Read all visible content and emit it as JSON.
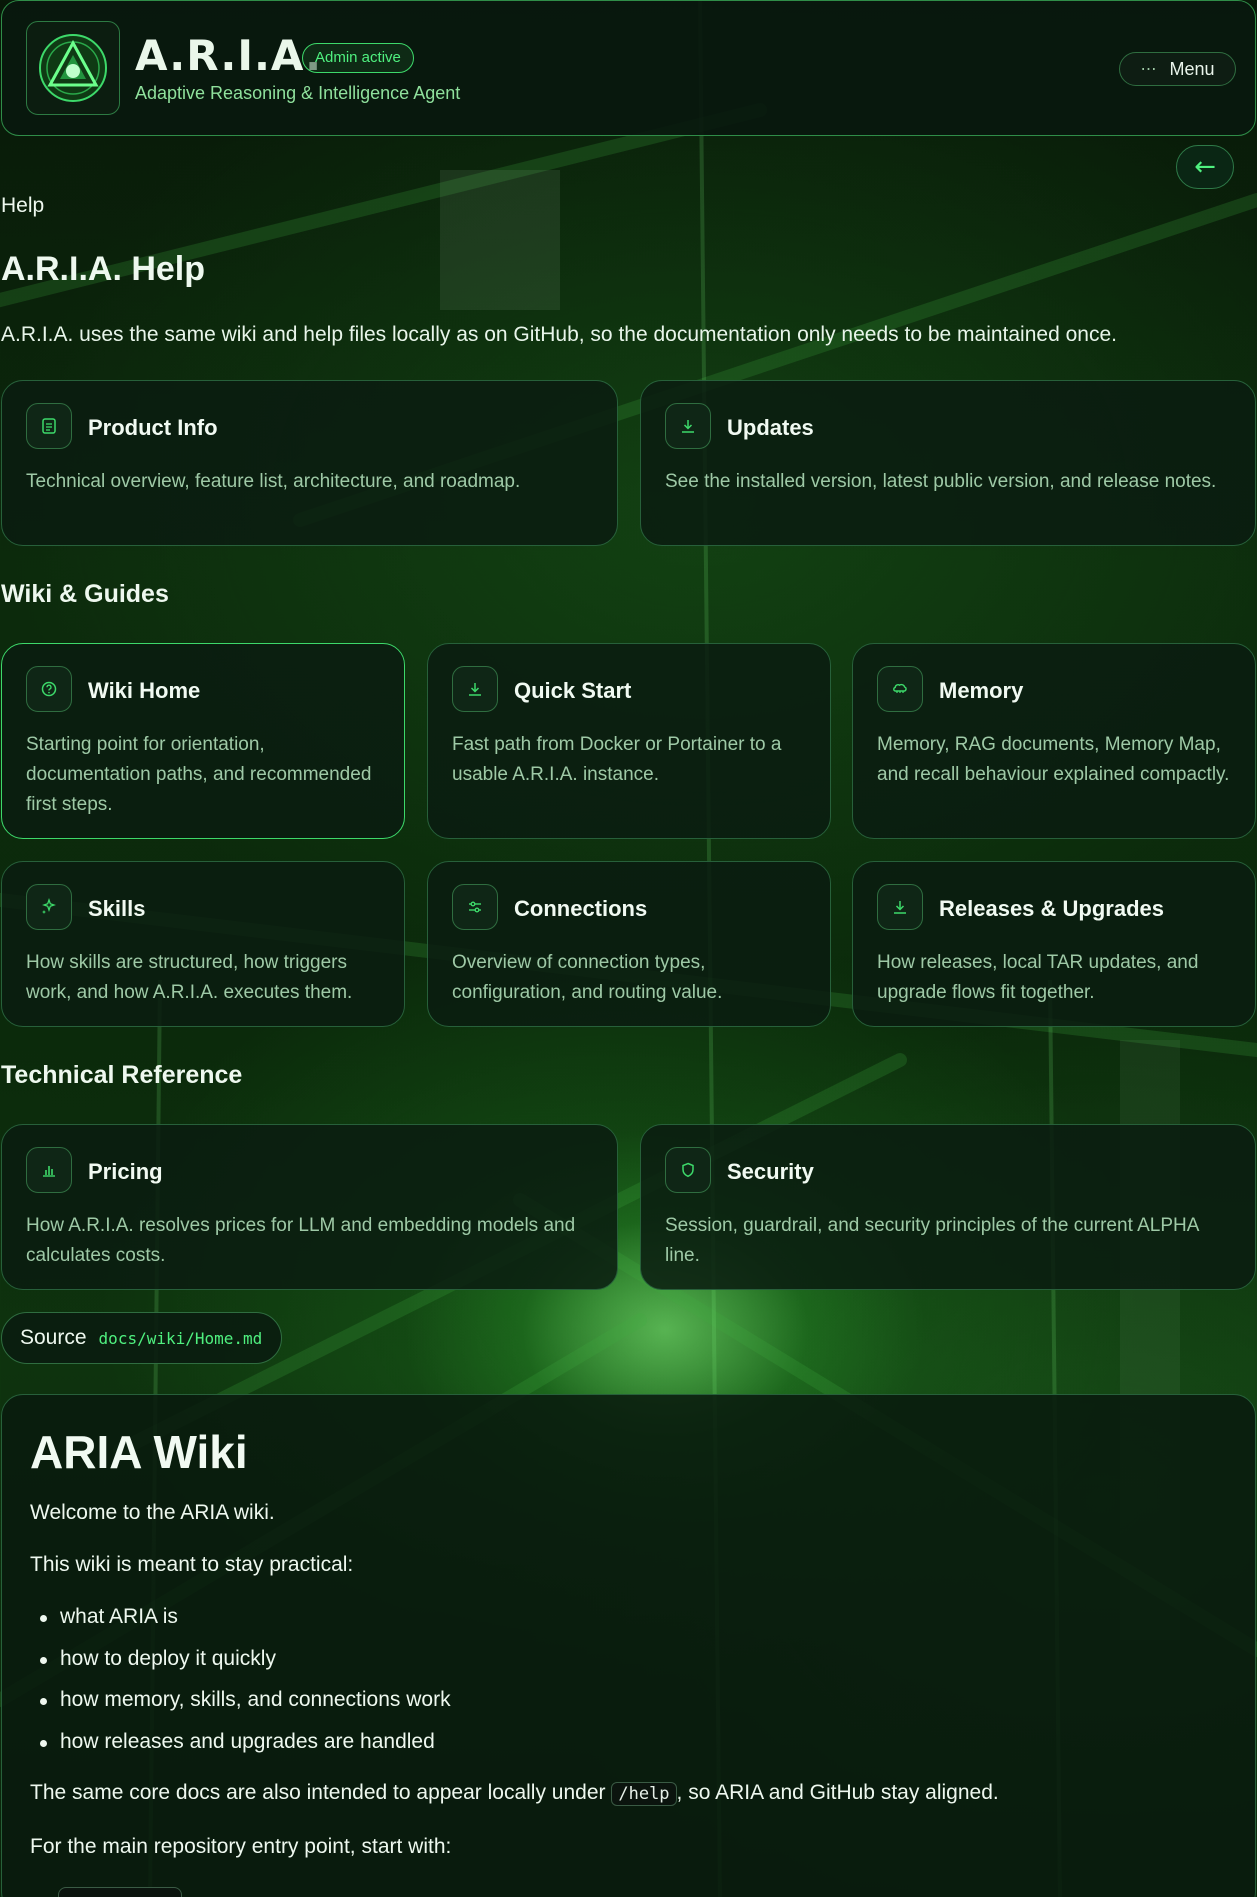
{
  "header": {
    "logo_icon": "aria-triangle-logo-icon",
    "title": "A.R.I.A.",
    "badge": "Admin active",
    "subtitle": "Adaptive Reasoning & Intelligence Agent",
    "menu_label": "Menu",
    "menu_icon": "ellipsis-icon",
    "back_label": "←"
  },
  "breadcrumb": "Help",
  "page_title": "A.R.I.A. Help",
  "intro": "A.R.I.A. uses the same wiki and help files locally as on GitHub, so the documentation only needs to be maintained once.",
  "top_cards": [
    {
      "icon": "document-icon",
      "title": "Product Info",
      "desc": "Technical overview, feature list, architecture, and roadmap."
    },
    {
      "icon": "download-icon",
      "title": "Updates",
      "desc": "See the installed version, latest public version, and release notes."
    }
  ],
  "wiki_section": {
    "title": "Wiki & Guides",
    "cards": [
      {
        "icon": "help-circle-icon",
        "title": "Wiki Home",
        "desc": "Starting point for orientation, documentation paths, and recommended first steps.",
        "active": true
      },
      {
        "icon": "download-icon",
        "title": "Quick Start",
        "desc": "Fast path from Docker or Portainer to a usable A.R.I.A. instance."
      },
      {
        "icon": "brain-icon",
        "title": "Memory",
        "desc": "Memory, RAG documents, Memory Map, and recall behaviour explained compactly."
      },
      {
        "icon": "sparkle-icon",
        "title": "Skills",
        "desc": "How skills are structured, how triggers work, and how A.R.I.A. executes them."
      },
      {
        "icon": "sliders-icon",
        "title": "Connections",
        "desc": "Overview of connection types, configuration, and routing value."
      },
      {
        "icon": "download-icon",
        "title": "Releases & Upgrades",
        "desc": "How releases, local TAR updates, and upgrade flows fit together."
      }
    ]
  },
  "tech_section": {
    "title": "Technical Reference",
    "cards": [
      {
        "icon": "bar-chart-icon",
        "title": "Pricing",
        "desc": "How A.R.I.A. resolves prices for LLM and embedding models and calculates costs."
      },
      {
        "icon": "shield-icon",
        "title": "Security",
        "desc": "Session, guardrail, and security principles of the current ALPHA line."
      }
    ]
  },
  "source": {
    "label": "Source",
    "path": "docs/wiki/Home.md"
  },
  "wiki": {
    "heading": "ARIA Wiki",
    "welcome": "Welcome to the ARIA wiki.",
    "lead": "This wiki is meant to stay practical:",
    "bullets": [
      "what ARIA is",
      "how to deploy it quickly",
      "how memory, skills, and connections work",
      "how releases and upgrades are handled"
    ],
    "aligned_before": "The same core docs are also intended to appear locally under ",
    "aligned_code": "/help",
    "aligned_after": ", so ARIA and GitHub stay aligned.",
    "entry": "For the main repository entry point, start with:"
  },
  "colors": {
    "accent": "#3dd96a",
    "background": "#0b2a0b",
    "card_border": "#27603a",
    "muted_text": "#9ec9a6"
  }
}
